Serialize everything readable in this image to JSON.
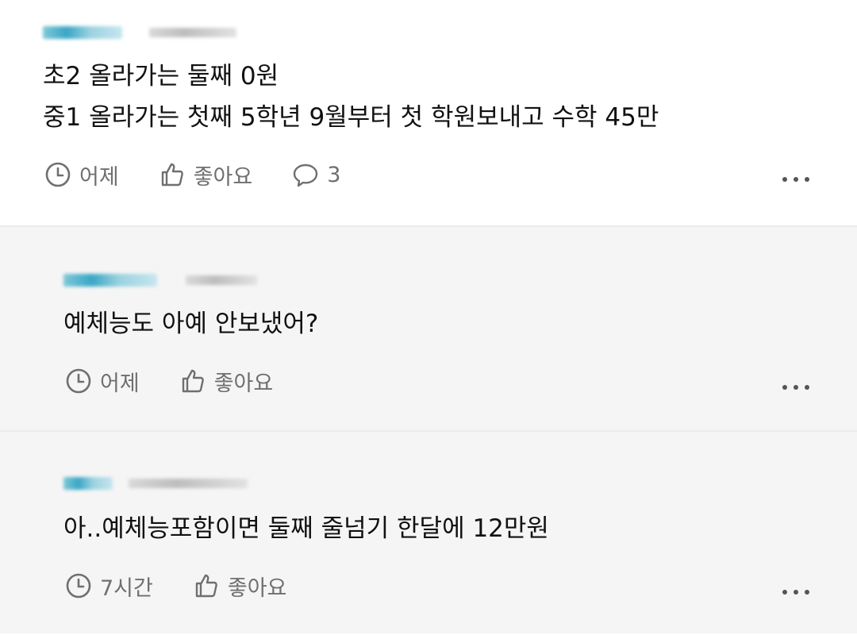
{
  "comments": [
    {
      "lines": [
        "초2 올라가는 둘째 0원",
        "중1 올라가는 첫째 5학년 9월부터 첫 학원보내고 수학 45만"
      ],
      "time": "어제",
      "like_label": "좋아요",
      "reply_count": "3"
    },
    {
      "lines": [
        "예체능도 아예 안보냈어?"
      ],
      "time": "어제",
      "like_label": "좋아요"
    },
    {
      "lines": [
        "아..예체능포함이면 둘째 줄넘기 한달에 12만원"
      ],
      "time": "7시간",
      "like_label": "좋아요"
    }
  ],
  "colors": {
    "reply_background": "#f5f5f5",
    "meta_text": "#6f6f6f",
    "body_text": "#111111"
  },
  "icons": {
    "time": "clock-icon",
    "like": "thumbs-up-icon",
    "reply": "speech-bubble-icon",
    "more": "more-dots-icon"
  }
}
